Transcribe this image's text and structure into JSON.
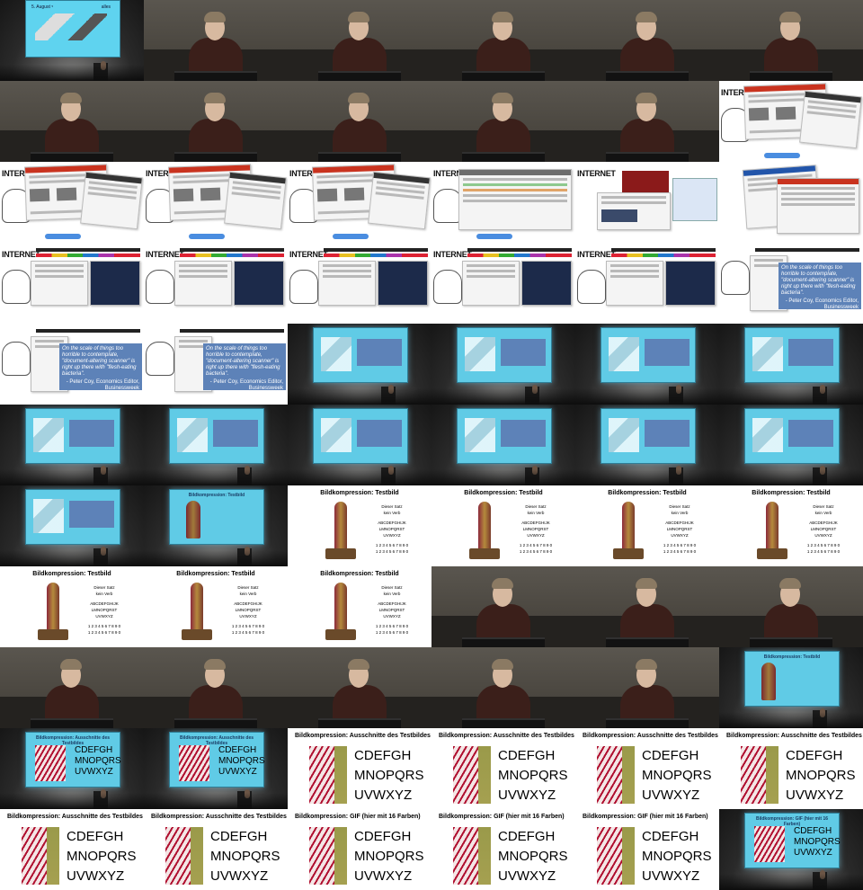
{
  "grid": {
    "columns": 6,
    "rows": 11
  },
  "slides": {
    "aug_left": "5. August ⁵",
    "aug_right": "alles",
    "internet_left": "l",
    "internet_label": "INTERNET",
    "internet_right": "lien",
    "quote_text": "On the scale of things too horrible to contemplate, \"document-altering scanner\" is right up there with \"flesh-eating bacteria\".",
    "quote_attr": "- Peter Coy, Economics Editor, Businessweek",
    "bild_title": "Bildkompression: Testbild",
    "bild_lines": [
      "Dieser Satz",
      "kein Verb",
      "ABCDEFGHIJK",
      "LMNOPQRST",
      "UVWXYZ",
      "1 2 3 4 5 6 7 8 9 0",
      "1 2 3 4 5 6 7 8 9 0"
    ],
    "crop_title": "Bildkompression: Ausschnitte des Testbildes",
    "gif_title": "Bildkompression: GIF (hier mit 16 Farben)",
    "crop_lines": [
      "CDEFGH",
      "MNOPQRS",
      "UVWXYZ"
    ],
    "proj_gif_title": "Bildkompression: GIF (hier mit 16 Farben)"
  },
  "cells": [
    "aug",
    "stage",
    "stage",
    "stage",
    "stage",
    "stage",
    "stage",
    "stage",
    "stage",
    "stage",
    "stage",
    "web1",
    "web1",
    "web1",
    "web1",
    "web2",
    "web3",
    "web4",
    "web5",
    "web5",
    "web5",
    "web5",
    "web5",
    "web6",
    "web6",
    "web6",
    "room-quote",
    "room-quote",
    "room-quote",
    "room-quote",
    "room-quote",
    "room-quote",
    "room-quote",
    "room-quote",
    "room-quote",
    "room-quote",
    "room-quote",
    "room-bild",
    "bild",
    "bild",
    "bild",
    "bild",
    "bild",
    "bild",
    "bild",
    "stage",
    "stage",
    "stage",
    "stage",
    "stage",
    "stage",
    "stage",
    "stage",
    "room-bild",
    "room-crop",
    "room-crop",
    "crop",
    "crop",
    "crop",
    "crop",
    "crop",
    "crop",
    "gif",
    "gif",
    "gif",
    "room-gif"
  ]
}
